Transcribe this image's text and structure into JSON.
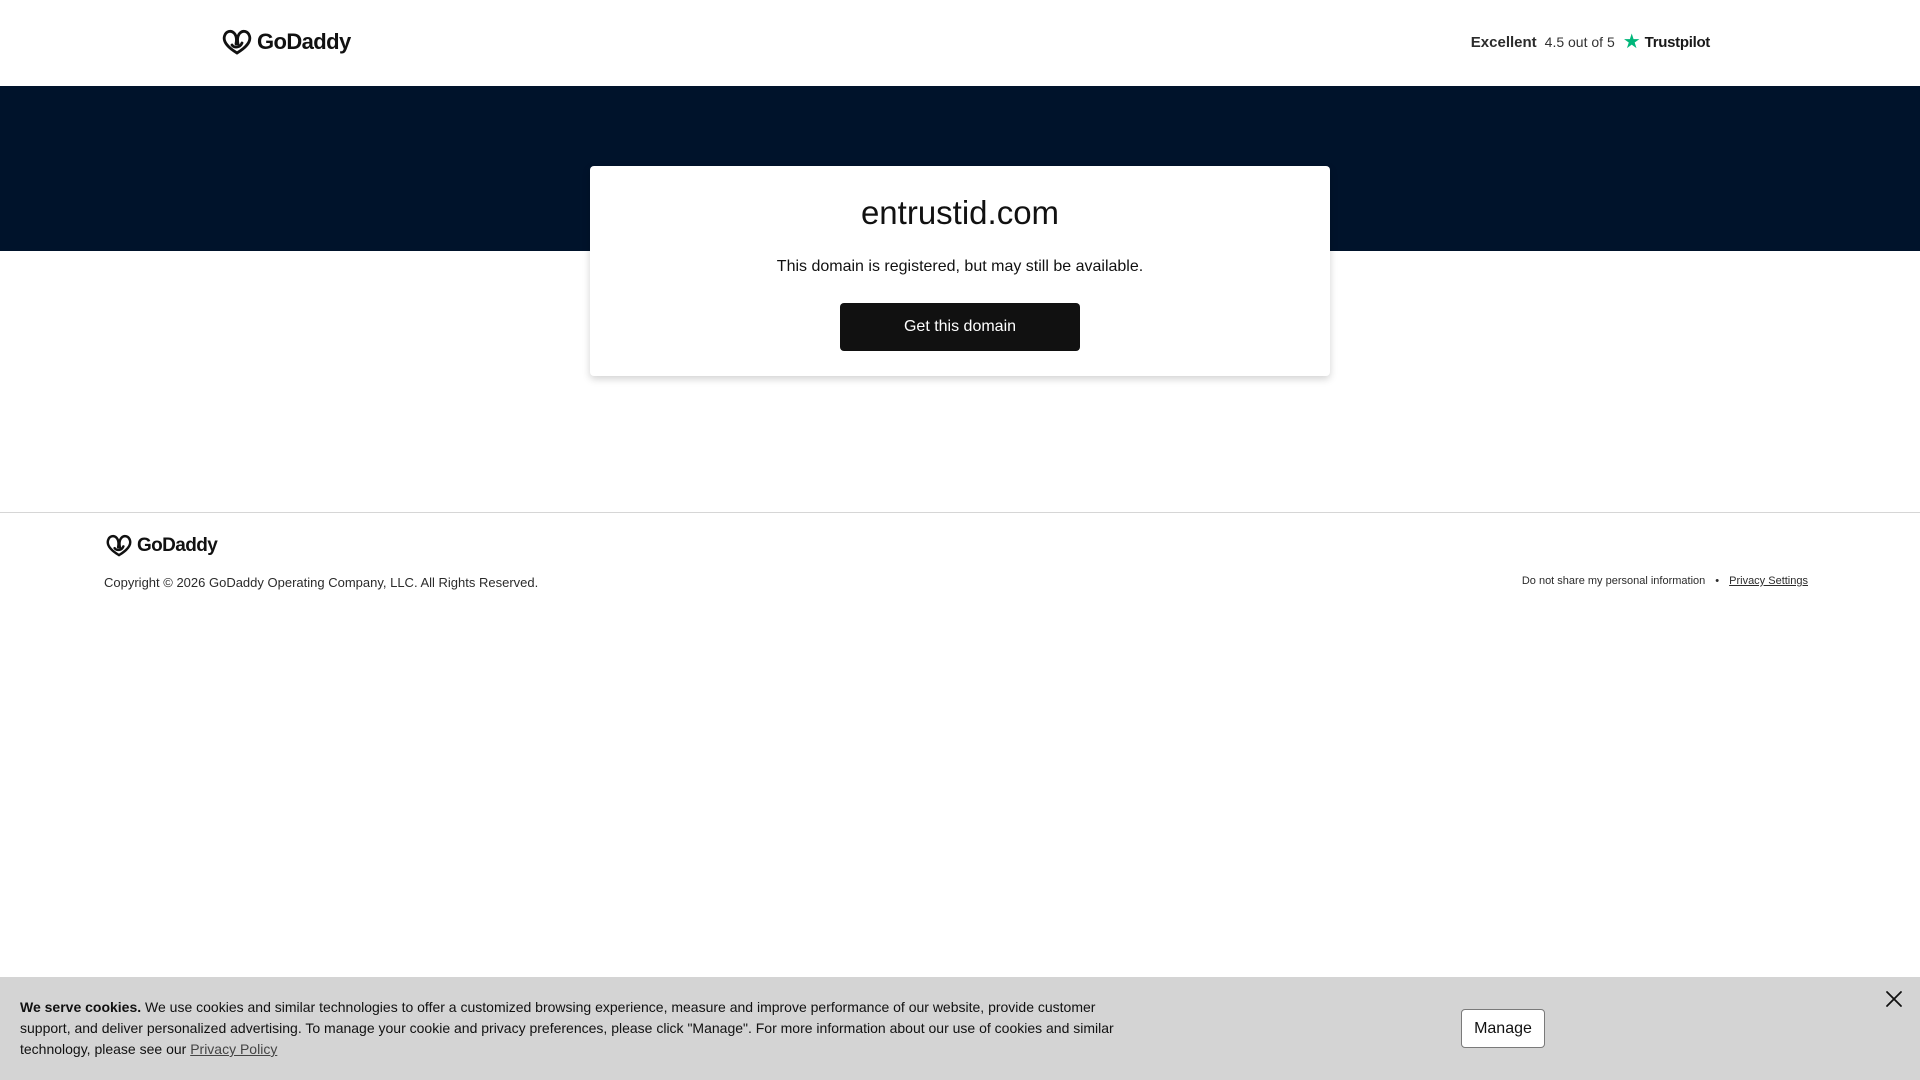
{
  "header": {
    "brand": "GoDaddy",
    "trustpilot": {
      "rating_label": "Excellent",
      "score": "4.5 out of 5",
      "brand": "Trustpilot",
      "star_color": "#00b67a"
    }
  },
  "card": {
    "domain": "entrustid.com",
    "message": "This domain is registered, but may still be available.",
    "cta_label": "Get this domain"
  },
  "footer": {
    "brand": "GoDaddy",
    "copyright": "Copyright © 2026 GoDaddy Operating Company, LLC. All Rights Reserved.",
    "no_share_label": "Do not share my personal information",
    "separator": "•",
    "privacy_settings_label": "Privacy Settings"
  },
  "cookie_banner": {
    "heading": "We serve cookies.",
    "body": " We use cookies and similar technologies to offer a customized browsing experience, measure and improve performance of our website, provide customer support, and deliver personalized advertising. To manage your cookie and privacy preferences, please click \"Manage\". For more information about our use of cookies and similar technology, please see our ",
    "policy_link": "Privacy Policy",
    "manage_label": "Manage",
    "close_icon": "close-icon"
  },
  "colors": {
    "hero_background": "#00132b",
    "button_background": "#111111",
    "cookie_background": "#d4d4d4"
  }
}
